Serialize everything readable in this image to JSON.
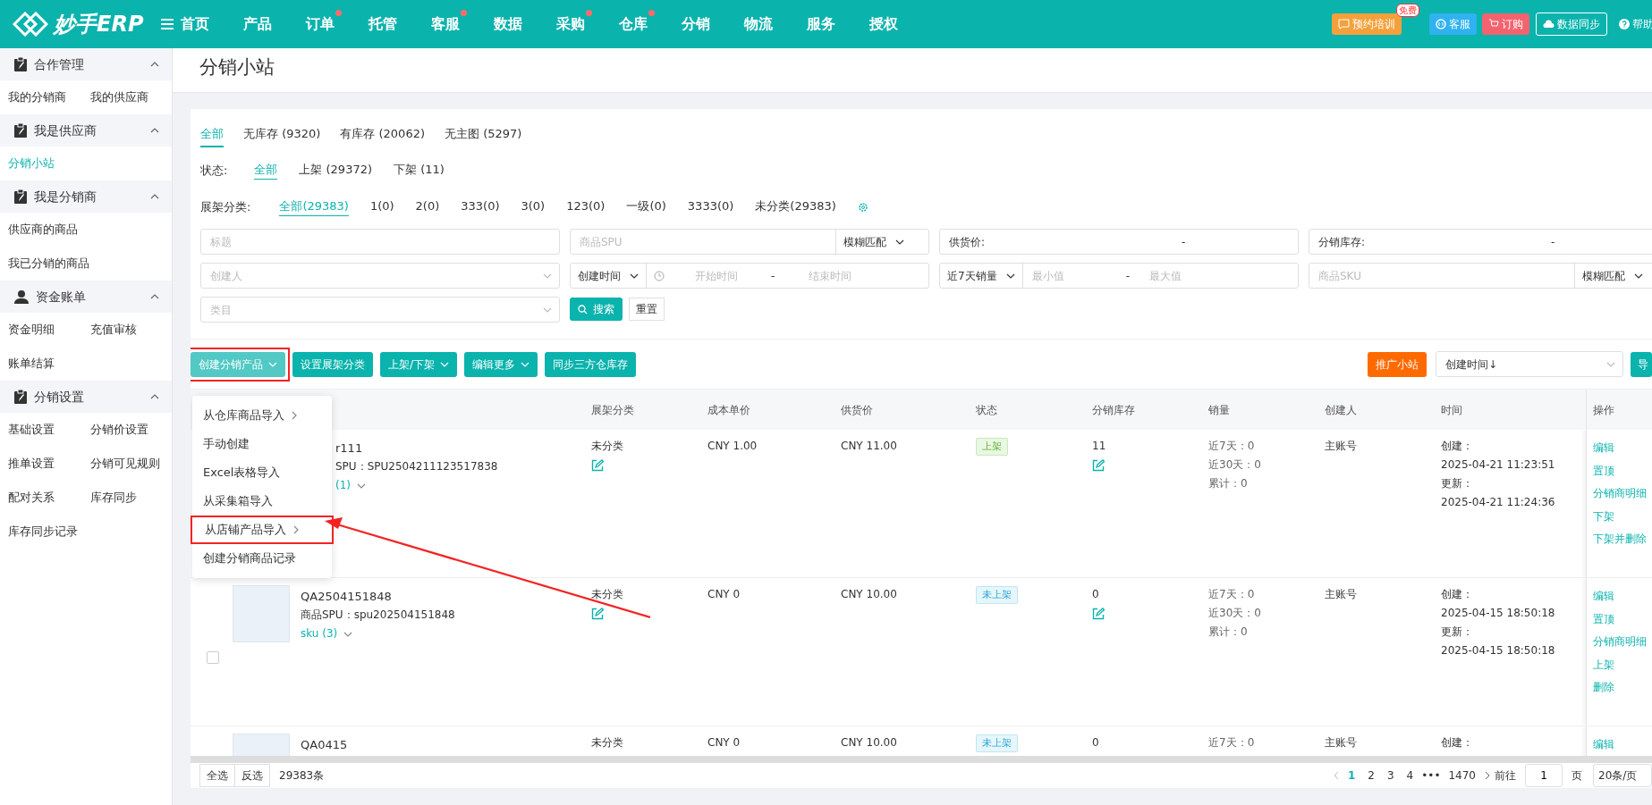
{
  "topbar": {
    "logo": "妙手ERP",
    "nav": [
      {
        "label": "首页",
        "dot": false
      },
      {
        "label": "产品",
        "dot": false
      },
      {
        "label": "订单",
        "dot": true
      },
      {
        "label": "托管",
        "dot": false
      },
      {
        "label": "客服",
        "dot": true
      },
      {
        "label": "数据",
        "dot": false
      },
      {
        "label": "采购",
        "dot": true
      },
      {
        "label": "仓库",
        "dot": true
      },
      {
        "label": "分销",
        "dot": false
      },
      {
        "label": "物流",
        "dot": false
      },
      {
        "label": "服务",
        "dot": false
      },
      {
        "label": "授权",
        "dot": false
      }
    ],
    "actions": [
      {
        "kind": "training",
        "label": "预约培训",
        "badge": "免费"
      },
      {
        "kind": "service",
        "label": "客服"
      },
      {
        "kind": "order",
        "label": "订购"
      },
      {
        "kind": "sync",
        "label": "数据同步"
      },
      {
        "kind": "help",
        "label": "帮助"
      }
    ]
  },
  "sidebar": [
    {
      "title": "合作管理",
      "expanded": true,
      "items": [
        {
          "label": "我的分销商",
          "selected": false
        },
        {
          "label": "我的供应商",
          "selected": false
        }
      ]
    },
    {
      "title": "我是供应商",
      "expanded": true,
      "items": [
        {
          "label": "分销小站",
          "selected": true
        }
      ]
    },
    {
      "title": "我是分销商",
      "expanded": true,
      "items": [
        {
          "label": "供应商的商品",
          "selected": false
        },
        {
          "label": "我已分销的商品",
          "selected": false
        }
      ]
    },
    {
      "title": "资金账单",
      "expanded": true,
      "items": [
        {
          "label": "资金明细",
          "selected": false
        },
        {
          "label": "充值审核",
          "selected": false
        },
        {
          "label": "账单结算",
          "selected": false
        }
      ]
    },
    {
      "title": "分销设置",
      "expanded": true,
      "items": [
        {
          "label": "基础设置",
          "selected": false
        },
        {
          "label": "分销价设置",
          "selected": false
        },
        {
          "label": "推单设置",
          "selected": false
        },
        {
          "label": "分销可见规则",
          "selected": false
        },
        {
          "label": "配对关系",
          "selected": false
        },
        {
          "label": "库存同步",
          "selected": false
        },
        {
          "label": "库存同步记录",
          "selected": false
        }
      ]
    }
  ],
  "page_title": "分销小站",
  "stock_tabs": [
    {
      "label": "全部",
      "selected": true
    },
    {
      "label": "无库存 (9320)",
      "selected": false
    },
    {
      "label": "有库存 (20062)",
      "selected": false
    },
    {
      "label": "无主图 (5297)",
      "selected": false
    }
  ],
  "status_filter": {
    "label": "状态:",
    "options": [
      {
        "label": "全部",
        "selected": true
      },
      {
        "label": "上架 (29372)",
        "selected": false
      },
      {
        "label": "下架 (11)",
        "selected": false
      }
    ]
  },
  "shelf_filter": {
    "label": "展架分类:",
    "options": [
      {
        "label": "全部(29383)",
        "selected": true
      },
      {
        "label": "1(0)",
        "selected": false
      },
      {
        "label": "2(0)",
        "selected": false
      },
      {
        "label": "333(0)",
        "selected": false
      },
      {
        "label": "3(0)",
        "selected": false
      },
      {
        "label": "123(0)",
        "selected": false
      },
      {
        "label": "一级(0)",
        "selected": false
      },
      {
        "label": "3333(0)",
        "selected": false
      },
      {
        "label": "未分类(29383)",
        "selected": false
      }
    ]
  },
  "filters": [
    [
      {
        "kind": "input",
        "placeholder": "标题"
      },
      {
        "kind": "input_select",
        "placeholder": "商品SPU",
        "select": "模糊匹配"
      },
      {
        "kind": "range",
        "label": "供货价:",
        "separator": "-"
      },
      {
        "kind": "range",
        "label": "分销库存:",
        "separator": "-"
      }
    ],
    [
      {
        "kind": "select",
        "placeholder": "创建人"
      },
      {
        "kind": "select_daterange",
        "select": "创建时间",
        "start": "开始时间",
        "separator": "-",
        "end": "结束时间"
      },
      {
        "kind": "select_range",
        "select": "近7天销量",
        "min": "最小值",
        "separator": "-",
        "max": "最大值"
      },
      {
        "kind": "input_select",
        "placeholder": "商品SKU",
        "select": "模糊匹配"
      }
    ],
    [
      {
        "kind": "select",
        "placeholder": "类目"
      },
      {
        "kind": "search",
        "label": "搜索"
      },
      {
        "kind": "reset",
        "label": "重置"
      }
    ]
  ],
  "toolbar": {
    "buttons": [
      {
        "label": "创建分销产品",
        "caret": true,
        "annotated": true,
        "open": true
      },
      {
        "label": "设置展架分类",
        "caret": false,
        "annotated": false,
        "open": false
      },
      {
        "label": "上架/下架",
        "caret": true,
        "annotated": false,
        "open": false
      },
      {
        "label": "编辑更多",
        "caret": true,
        "annotated": false,
        "open": false
      },
      {
        "label": "同步三方仓库存",
        "caret": false,
        "annotated": false,
        "open": false
      }
    ],
    "promote": "推广小站",
    "sort": "创建时间↓",
    "edge_button": "导"
  },
  "dropdown": [
    {
      "label": "从仓库商品导入",
      "submenu": true,
      "annotated": false
    },
    {
      "label": "手动创建",
      "submenu": false,
      "annotated": false
    },
    {
      "label": "Excel表格导入",
      "submenu": false,
      "annotated": false
    },
    {
      "label": "从采集箱导入",
      "submenu": false,
      "annotated": false
    },
    {
      "label": "从店铺产品导入",
      "submenu": true,
      "annotated": true
    },
    {
      "label": "创建分销商品记录",
      "submenu": false,
      "annotated": false
    }
  ],
  "table": {
    "columns": [
      "展架分类",
      "成本单价",
      "供货价",
      "状态",
      "分销库存",
      "销量",
      "创建人",
      "时间",
      "操作"
    ],
    "rows": [
      {
        "checkbox": false,
        "image": false,
        "title": "r111",
        "spu_label": "SPU：",
        "spu": "SPU2504211123517838",
        "sku": "(1)",
        "sku_expanded": false,
        "shelf": "未分类",
        "cost": "CNY 1.00",
        "price": "CNY 11.00",
        "status": {
          "label": "上架",
          "listed": true
        },
        "stock": "11",
        "sales": [
          "近7天：0",
          "近30天：0",
          "累计：0"
        ],
        "creator": "主账号",
        "time": [
          "创建：",
          "2025-04-21 11:23:51",
          "更新：",
          "2025-04-21 11:24:36"
        ],
        "actions": [
          "编辑",
          "置顶",
          "分销商明细",
          "下架",
          "下架并删除"
        ]
      },
      {
        "checkbox": true,
        "checked": false,
        "image": true,
        "title": "QA2504151848",
        "spu_label": "商品SPU：",
        "spu": "spu202504151848",
        "sku": "sku (3)",
        "sku_expanded": false,
        "shelf": "未分类",
        "cost": "CNY 0",
        "price": "CNY 10.00",
        "status": {
          "label": "未上架",
          "listed": false
        },
        "stock": "0",
        "sales": [
          "近7天：0",
          "近30天：0",
          "累计：0"
        ],
        "creator": "主账号",
        "time": [
          "创建：",
          "2025-04-15 18:50:18",
          "更新：",
          "2025-04-15 18:50:18"
        ],
        "actions": [
          "编辑",
          "置顶",
          "分销商明细",
          "上架",
          "删除"
        ]
      },
      {
        "checkbox": false,
        "image": true,
        "title": "QA0415",
        "shelf": "未分类",
        "cost": "CNY 0",
        "price": "CNY 10.00",
        "status": {
          "label": "未上架",
          "listed": false
        },
        "stock": "0",
        "sales": [
          "近7天：0"
        ],
        "creator": "主账号",
        "time": [
          "创建："
        ],
        "actions": [
          "编辑"
        ]
      }
    ]
  },
  "footer": {
    "select_all": "全选",
    "invert": "反选",
    "total": "29383条",
    "pages": [
      {
        "label": "1",
        "selected": true
      },
      {
        "label": "2",
        "selected": false
      },
      {
        "label": "3",
        "selected": false
      },
      {
        "label": "4",
        "selected": false
      }
    ],
    "ellipsis": "•••",
    "last_page": "1470",
    "goto_label": "前往",
    "goto_value": "1",
    "page_unit": "页",
    "page_size": "20条/页"
  }
}
